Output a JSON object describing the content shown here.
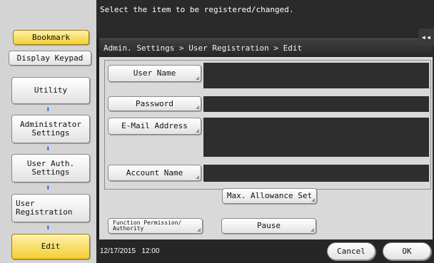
{
  "header": {
    "message": "Select the item to be registered/changed."
  },
  "left_nav": {
    "bookmark_label": "Bookmark",
    "display_keypad_label": "Display Keypad",
    "utility_label": "Utility",
    "administrator_settings_label": "Administrator\nSettings",
    "user_auth_settings_label": "User Auth.\nSettings",
    "user_registration_label": "User\nRegistration",
    "edit_label": "Edit",
    "arrow_glyph": "⬇"
  },
  "dialog": {
    "breadcrumb": "Admin. Settings > User Registration > Edit",
    "collapse_glyph": "◂◂",
    "fields": {
      "user_name_label": "User Name",
      "password_label": "Password",
      "email_label": "E-Mail Address",
      "account_name_label": "Account Name"
    },
    "max_allowance_label": "Max. Allowance Set",
    "function_permission_label": "Function Permission/\nAuthority",
    "pause_label": "Pause"
  },
  "footer": {
    "date": "12/17/2015",
    "time": "12:00",
    "cancel_label": "Cancel",
    "ok_label": "OK"
  },
  "colors": {
    "accent_yellow": "#f3cf33",
    "arrow_blue": "#1a5bd6",
    "dark_bg": "#2a2a2a"
  }
}
